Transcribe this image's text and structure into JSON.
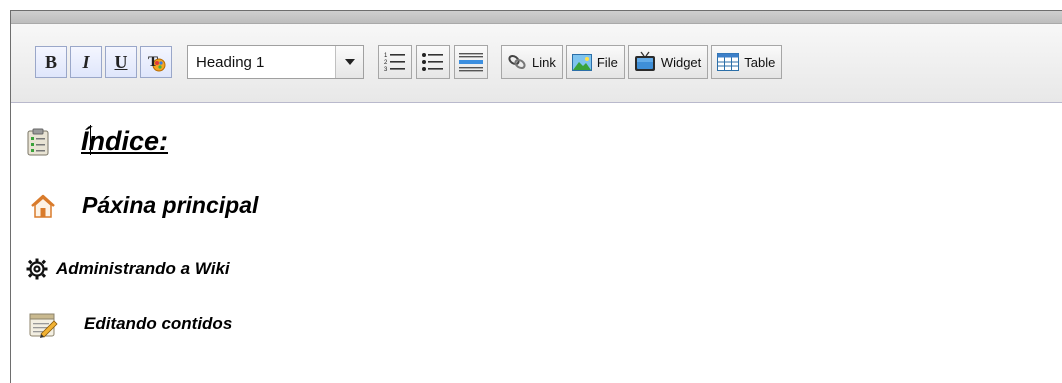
{
  "toolbar": {
    "format": {
      "bold": "B",
      "italic": "I",
      "underline": "U"
    },
    "style_select": {
      "value": "Heading 1"
    },
    "insert": {
      "link": "Link",
      "file": "File",
      "widget": "Widget",
      "table": "Table"
    }
  },
  "content": {
    "index_heading": "Índice:",
    "items": [
      {
        "label": "Páxina principal",
        "icon": "home-icon"
      },
      {
        "label": "Administrando a Wiki",
        "icon": "gear-icon"
      },
      {
        "label": "Editando contidos",
        "icon": "notepad-pencil-icon"
      }
    ]
  },
  "colors": {
    "toolbar_border": "#b9b9cc",
    "button_blue_border": "#9aa7c9"
  }
}
